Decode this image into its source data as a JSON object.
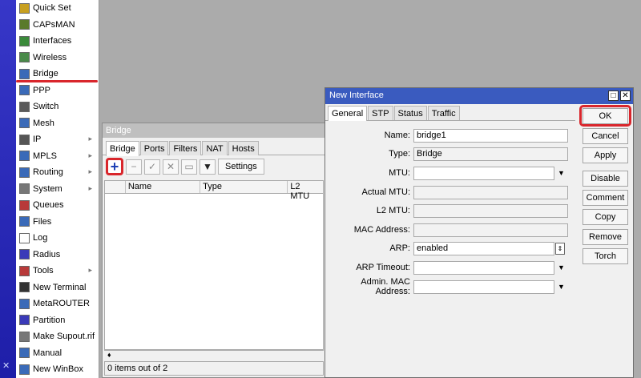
{
  "sidebar": {
    "items": [
      {
        "label": "Quick Set",
        "icon": "quick-set-icon",
        "color": "#c8a020",
        "arrow": false
      },
      {
        "label": "CAPsMAN",
        "icon": "capsman-icon",
        "color": "#5a7a2a",
        "arrow": false
      },
      {
        "label": "Interfaces",
        "icon": "interfaces-icon",
        "color": "#3a8a3a",
        "arrow": false
      },
      {
        "label": "Wireless",
        "icon": "wireless-icon",
        "color": "#4a8a4a",
        "arrow": false
      },
      {
        "label": "Bridge",
        "icon": "bridge-icon",
        "color": "#3a6ab8",
        "arrow": false
      },
      {
        "label": "PPP",
        "icon": "ppp-icon",
        "color": "#3a6ab8",
        "arrow": false
      },
      {
        "label": "Switch",
        "icon": "switch-icon",
        "color": "#5a5a5a",
        "arrow": false
      },
      {
        "label": "Mesh",
        "icon": "mesh-icon",
        "color": "#3a6ab8",
        "arrow": false
      },
      {
        "label": "IP",
        "icon": "ip-icon",
        "color": "#555555",
        "arrow": true
      },
      {
        "label": "MPLS",
        "icon": "mpls-icon",
        "color": "#3a6ab8",
        "arrow": true
      },
      {
        "label": "Routing",
        "icon": "routing-icon",
        "color": "#3a6ab8",
        "arrow": true
      },
      {
        "label": "System",
        "icon": "system-icon",
        "color": "#777777",
        "arrow": true
      },
      {
        "label": "Queues",
        "icon": "queues-icon",
        "color": "#b83a3a",
        "arrow": false
      },
      {
        "label": "Files",
        "icon": "files-icon",
        "color": "#3a6ab8",
        "arrow": false
      },
      {
        "label": "Log",
        "icon": "log-icon",
        "color": "#ffffff",
        "arrow": false
      },
      {
        "label": "Radius",
        "icon": "radius-icon",
        "color": "#3a3ab8",
        "arrow": false
      },
      {
        "label": "Tools",
        "icon": "tools-icon",
        "color": "#b83a3a",
        "arrow": true
      },
      {
        "label": "New Terminal",
        "icon": "terminal-icon",
        "color": "#333333",
        "arrow": false
      },
      {
        "label": "MetaROUTER",
        "icon": "metarouter-icon",
        "color": "#3a6ab8",
        "arrow": false
      },
      {
        "label": "Partition",
        "icon": "partition-icon",
        "color": "#3a3ab8",
        "arrow": false
      },
      {
        "label": "Make Supout.rif",
        "icon": "supout-icon",
        "color": "#777777",
        "arrow": false
      },
      {
        "label": "Manual",
        "icon": "manual-icon",
        "color": "#3a6ab8",
        "arrow": false
      },
      {
        "label": "New WinBox",
        "icon": "winbox-icon",
        "color": "#3a6ab8",
        "arrow": false
      }
    ]
  },
  "bridge_window": {
    "title": "Bridge",
    "tabs": [
      "Bridge",
      "Ports",
      "Filters",
      "NAT",
      "Hosts"
    ],
    "settings_label": "Settings",
    "columns": [
      "Name",
      "Type",
      "L2 MTU"
    ],
    "footer_marker": "♦",
    "status": "0 items out of 2"
  },
  "dialog": {
    "title": "New Interface",
    "tabs": [
      "General",
      "STP",
      "Status",
      "Traffic"
    ],
    "fields": {
      "name": {
        "label": "Name:",
        "value": "bridge1"
      },
      "type": {
        "label": "Type:",
        "value": "Bridge"
      },
      "mtu": {
        "label": "MTU:",
        "value": ""
      },
      "actual_mtu": {
        "label": "Actual MTU:",
        "value": ""
      },
      "l2_mtu": {
        "label": "L2 MTU:",
        "value": ""
      },
      "mac": {
        "label": "MAC Address:",
        "value": ""
      },
      "arp": {
        "label": "ARP:",
        "value": "enabled"
      },
      "arp_timeout": {
        "label": "ARP Timeout:",
        "value": ""
      },
      "admin_mac": {
        "label": "Admin. MAC Address:",
        "value": ""
      }
    },
    "buttons": {
      "ok": "OK",
      "cancel": "Cancel",
      "apply": "Apply",
      "disable": "Disable",
      "comment": "Comment",
      "copy": "Copy",
      "remove": "Remove",
      "torch": "Torch"
    }
  },
  "colors": {
    "highlight_red": "#d9262c",
    "title_bar_blue": "#3a5bbf",
    "strip_blue": "#2a2ab8"
  }
}
